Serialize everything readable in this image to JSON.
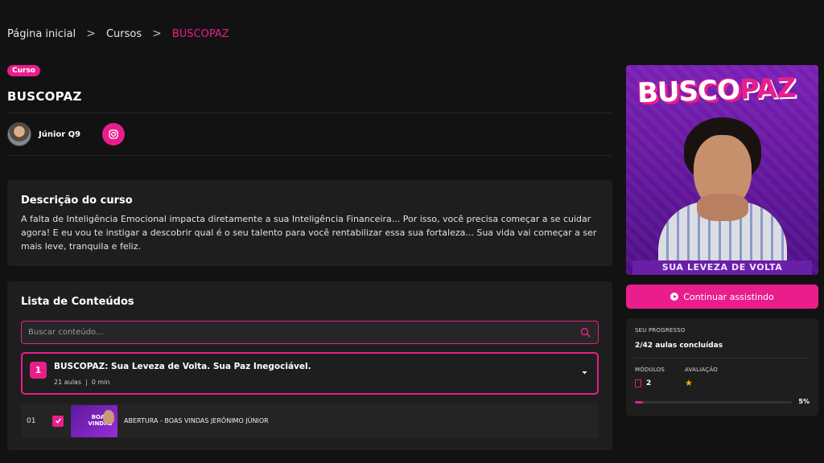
{
  "breadcrumb": {
    "home": "Página inicial",
    "courses": "Cursos",
    "current": "BUSCOPAZ",
    "separator": ">"
  },
  "course": {
    "badge": "Curso",
    "title": "BUSCOPAZ"
  },
  "author": {
    "name": "Júnior Q9",
    "social_icon": "instagram-icon"
  },
  "description": {
    "heading": "Descrição do curso",
    "text": "A falta de Inteligência Emocional impacta diretamente a sua Inteligência Financeira... Por isso, você precisa começar a se cuidar agora! E eu vou te instigar a descobrir qual é o seu talento para você rentabilizar essa sua fortaleza... Sua vida vai começar a ser mais leve, tranquila e feliz."
  },
  "contents": {
    "heading": "Lista de Conteúdos",
    "search_placeholder": "Buscar conteúdo...",
    "modules": [
      {
        "number": "1",
        "title": "BUSCOPAZ: Sua Leveza de Volta. Sua Paz Inegociável.",
        "lessons_count": "21 aulas",
        "meta_separator": "|",
        "duration": "0 min",
        "expanded": true
      }
    ],
    "lessons": [
      {
        "index": "01",
        "completed": true,
        "thumb_text": "BOAS VINDAS",
        "title": "ABERTURA - BOAS VINDAS JERÔNIMO JÚNIOR"
      }
    ]
  },
  "cover": {
    "title_white": "BUSCO",
    "title_pink": "PAZ",
    "banner": "SUA LEVEZA DE VOLTA"
  },
  "actions": {
    "continue_label": "Continuar assistindo"
  },
  "progress": {
    "label": "SEU PROGRESSO",
    "value": "2/42 aulas concluídas",
    "modules_label": "MÓDULOS",
    "modules_value": "2",
    "rating_label": "AVALIAÇÃO",
    "rating_stars": 1,
    "percent": 5,
    "percent_label": "5%"
  },
  "colors": {
    "accent": "#e91e8c",
    "background": "#121212",
    "card": "#1e1e1e",
    "star": "#f5b400"
  }
}
